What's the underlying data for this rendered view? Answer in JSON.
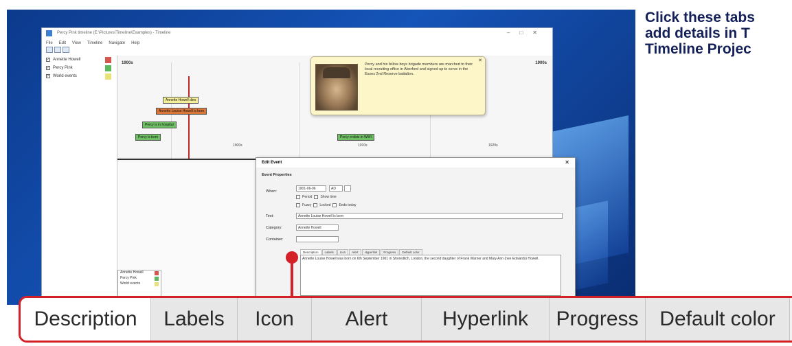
{
  "headline": {
    "line1": "Click these tabs",
    "line2": "add details in T",
    "line3": "Timeline Projec"
  },
  "app": {
    "title": "Percy Pink timeline (E:\\Pictures\\Timeline\\Examples) - Timeline",
    "menu": [
      "File",
      "Edit",
      "View",
      "Timeline",
      "Navigate",
      "Help"
    ],
    "categories": [
      {
        "label": "Annette Howell",
        "color": "#d9534f"
      },
      {
        "label": "Percy Pink",
        "color": "#5cb85c"
      },
      {
        "label": "World events",
        "color": "#e9e27a"
      }
    ],
    "era_left": "1900s",
    "era_right": "1900s",
    "ticks": [
      "1900s",
      "1910s",
      "1920s"
    ],
    "events": [
      {
        "label": "Annette Howell dies",
        "color": "#f5ef9a"
      },
      {
        "label": "Annette Louise Howell is born",
        "color": "#d9763a"
      },
      {
        "label": "Percy is in hospital",
        "color": "#6fbf64"
      },
      {
        "label": "Percy is born",
        "color": "#6fbf64"
      },
      {
        "label": "Percy enlists in WWI",
        "color": "#6fbf64"
      }
    ],
    "popup_text": "Percy and his fellow boys brigade members are marched to their local recruiting office in Aberford and signed up to serve in the Essex 2nd Reserve battalion.",
    "legend": [
      "Annette Howell",
      "Percy Pink",
      "World events"
    ]
  },
  "dialog": {
    "title": "Edit Event",
    "section": "Event Properties",
    "when_label": "When:",
    "when_value": "1901-06-06",
    "era_value": "AD",
    "period_cb": "Period",
    "show_time_cb": "Show time",
    "fuzzy_cb": "Fuzzy",
    "locked_cb": "Locked",
    "ends_today_cb": "Ends today",
    "text_label": "Text:",
    "text_value": "Annette Louise Howell is born",
    "category_label": "Category:",
    "category_value": "Annette Howell",
    "container_label": "Container:",
    "mini_tabs": [
      "Description",
      "Labels",
      "Icon",
      "Alert",
      "Hyperlink",
      "Progress",
      "Default color"
    ],
    "description": "Annette Louise Howell was born on 6th September 1901 in Shoreditch, London, the second daughter of Frank Warner and Mary Ann (nee Edwards) Howell."
  },
  "tabs": [
    "Description",
    "Labels",
    "Icon",
    "Alert",
    "Hyperlink",
    "Progress",
    "Default color"
  ],
  "accent_color": "#d42027"
}
